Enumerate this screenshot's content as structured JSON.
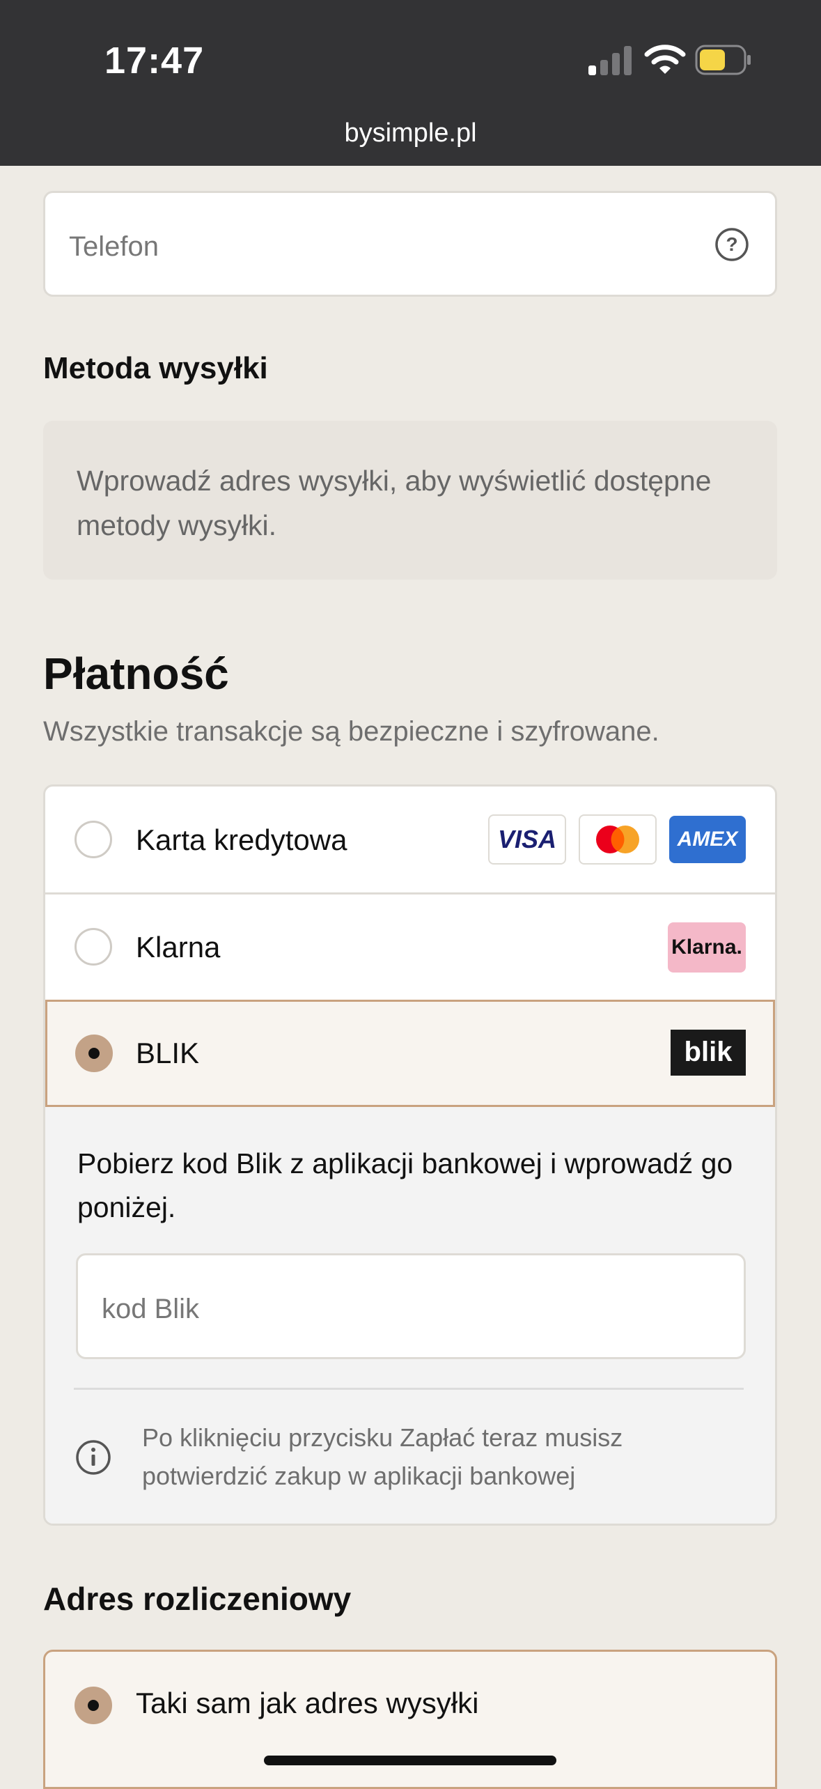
{
  "status_bar": {
    "time": "17:47",
    "url": "bysimple.pl"
  },
  "contact": {
    "phone_placeholder": "Telefon"
  },
  "shipping": {
    "heading": "Metoda wysyłki",
    "note": "Wprowadź adres wysyłki, aby wyświetlić dostępne metody wysyłki."
  },
  "payment": {
    "heading": "Płatność",
    "subtitle": "Wszystkie transakcje są bezpieczne i szyfrowane.",
    "options": [
      {
        "label": "Karta kredytowa",
        "selected": false,
        "badges": [
          "VISA",
          "mastercard",
          "AMEX"
        ]
      },
      {
        "label": "Klarna",
        "selected": false,
        "badges": [
          "Klarna."
        ]
      },
      {
        "label": "BLIK",
        "selected": true,
        "badges": [
          "blik"
        ]
      }
    ],
    "blik": {
      "instructions": "Pobierz kod Blik z aplikacji bankowej i wprowadź go poniżej.",
      "code_placeholder": "kod Blik",
      "note": "Po kliknięciu przycisku Zapłać teraz musisz potwierdzić zakup w aplikacji bankowej"
    }
  },
  "billing": {
    "heading": "Adres rozliczeniowy",
    "option_label": "Taki sam jak adres wysyłki"
  },
  "colors": {
    "accent": "#c3a287",
    "selected_border": "#c9a27f",
    "page_bg": "#eeebe5",
    "amex_blue": "#2f6fd0",
    "klarna_pink": "#f4b8c8"
  }
}
